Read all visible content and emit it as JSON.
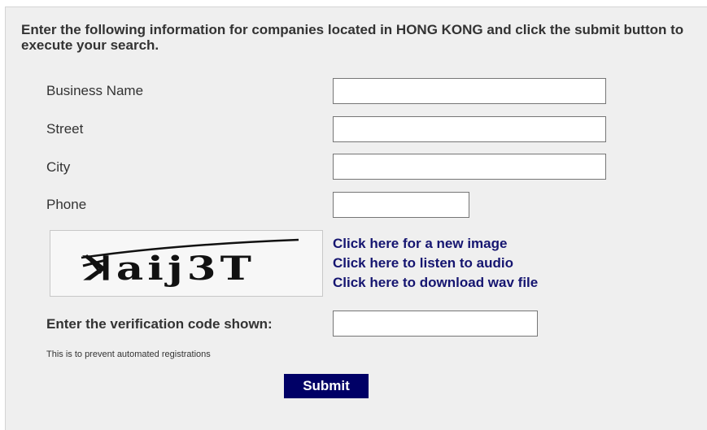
{
  "form": {
    "instructions": "Enter the following information for companies located in HONG KONG and click the submit button to execute your search.",
    "fields": {
      "business_name": {
        "label": "Business Name",
        "value": ""
      },
      "street": {
        "label": "Street",
        "value": ""
      },
      "city": {
        "label": "City",
        "value": ""
      },
      "phone": {
        "label": "Phone",
        "value": ""
      }
    },
    "captcha": {
      "image_text": "ꓘaij3T",
      "links": {
        "new_image": "Click here for a new image",
        "listen_audio": "Click here to listen to audio",
        "download_wav": "Click here to download wav file"
      },
      "code_label": "Enter the verification code shown:",
      "code_value": "",
      "note": "This is to prevent automated registrations"
    },
    "submit_label": "Submit"
  },
  "colors": {
    "panel_background": "#efefef",
    "link": "#151570",
    "submit_background": "#000066"
  }
}
